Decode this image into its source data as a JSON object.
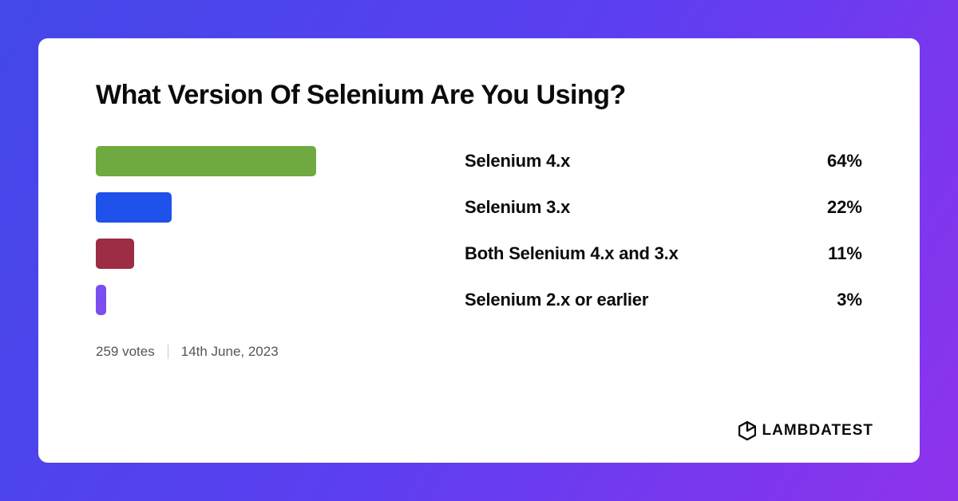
{
  "chart_data": {
    "type": "bar",
    "title": "What Version Of Selenium Are You Using?",
    "categories": [
      "Selenium 4.x",
      "Selenium 3.x",
      "Both Selenium 4.x and 3.x",
      "Selenium 2.x or earlier"
    ],
    "values": [
      64,
      22,
      11,
      3
    ],
    "colors": [
      "#6eaa3f",
      "#1f52ea",
      "#9d2c45",
      "#7b4ef0"
    ],
    "value_suffix": "%",
    "xlabel": "",
    "ylabel": "",
    "ylim": [
      0,
      100
    ]
  },
  "meta": {
    "votes": "259 votes",
    "date": "14th June, 2023"
  },
  "brand": {
    "name": "LAMBDATEST"
  }
}
